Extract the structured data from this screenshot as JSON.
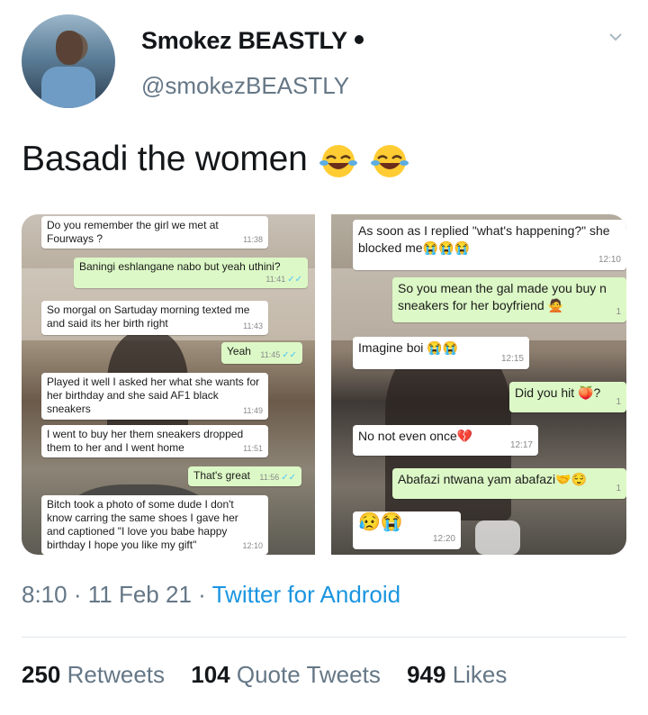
{
  "author": {
    "name": "Smokez BEASTLY",
    "handle": "@smokezBEASTLY"
  },
  "tweet": {
    "text": "Basadi the women",
    "emoji": [
      "face-with-tears-of-joy",
      "face-with-tears-of-joy"
    ]
  },
  "left_screenshot": {
    "messages": [
      {
        "text": "Do you remember the girl we met at Fourways ?",
        "time": "11:38",
        "outgoing": false
      },
      {
        "text": "Baningi eshlangane nabo but yeah uthini?",
        "time": "11:41",
        "outgoing": true
      },
      {
        "text": "So morgal on Sartuday morning  texted me and said its her birth right",
        "time": "11:43",
        "outgoing": false
      },
      {
        "text": "Yeah",
        "time": "11:45",
        "outgoing": true
      },
      {
        "text": "Played it well I  asked her what she wants for her birthday  and she said AF1 black sneakers",
        "time": "11:49",
        "outgoing": false
      },
      {
        "text": "I went to buy her them sneakers dropped them to her  and I went home",
        "time": "11:51",
        "outgoing": false
      },
      {
        "text": "That's great",
        "time": "11:56",
        "outgoing": true
      },
      {
        "text": "Bitch took a photo of some dude I  don't know carring the same shoes I gave  her and captioned  \"I  love you babe happy birthday I hope you like  my gift\"",
        "time": "12:10",
        "outgoing": false
      }
    ]
  },
  "right_screenshot": {
    "messages": [
      {
        "text": "As soon as I replied \"what's happening?\" she blocked me",
        "time": "12:10",
        "outgoing": false
      },
      {
        "text": "So you mean the gal made you buy n sneakers for her boyfriend",
        "time": "1",
        "outgoing": true
      },
      {
        "text": "Imagine  boi",
        "time": "12:15",
        "outgoing": false
      },
      {
        "text": "Did you hit",
        "suffix": "?",
        "time": "1",
        "outgoing": true
      },
      {
        "text": "No not even once",
        "time": "12:17",
        "outgoing": false
      },
      {
        "text": "Abafazi ntwana yam abafazi",
        "time": "1",
        "outgoing": true
      },
      {
        "text": "",
        "time": "12:20",
        "outgoing": false
      }
    ]
  },
  "meta": {
    "time": "8:10",
    "separator": "·",
    "date": "11 Feb 21",
    "source": "Twitter for Android"
  },
  "stats": {
    "retweets_count": "250",
    "retweets_label": "Retweets",
    "quotes_count": "104",
    "quotes_label": "Quote Tweets",
    "likes_count": "949",
    "likes_label": "Likes"
  },
  "colors": {
    "link": "#1b95e0",
    "secondary_text": "#657786",
    "primary_text": "#14171a",
    "outgoing_bubble": "#dcf8c6"
  }
}
